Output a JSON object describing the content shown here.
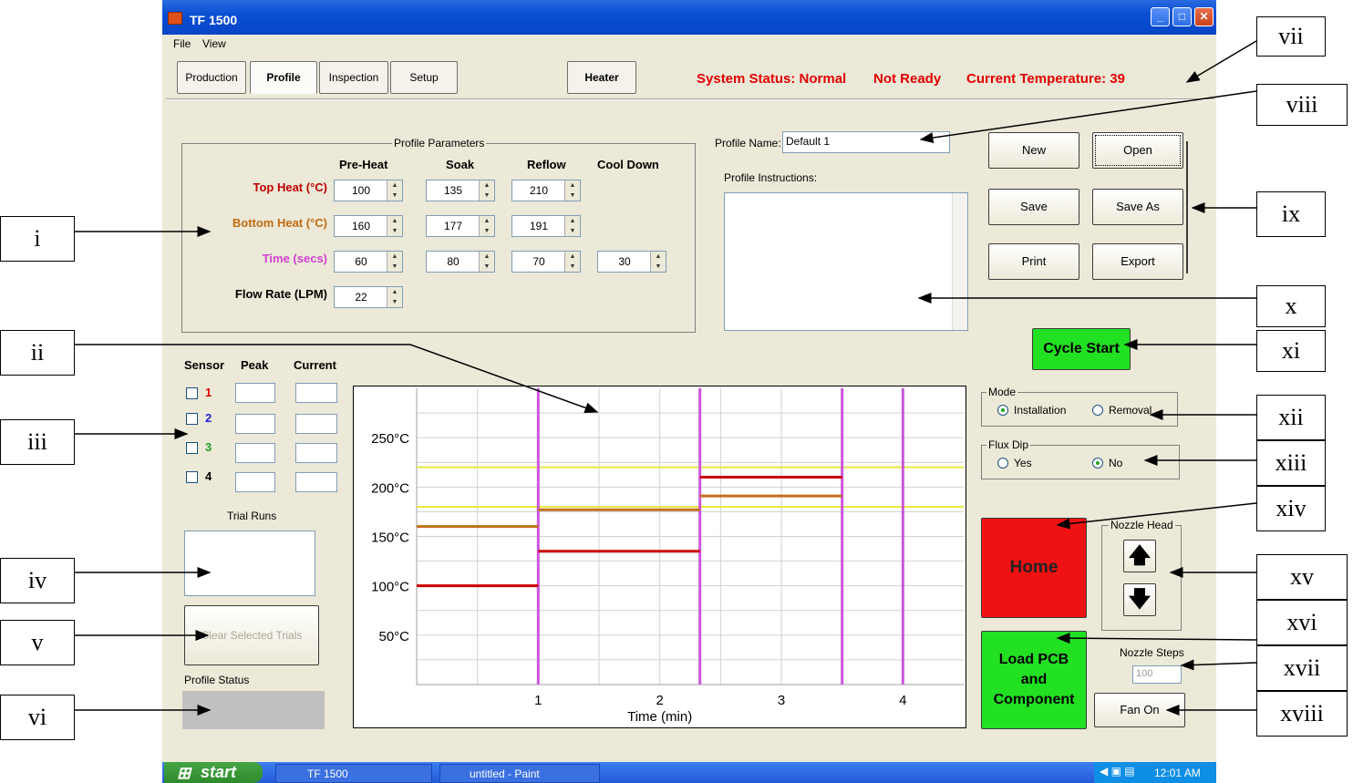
{
  "window": {
    "title": "TF 1500"
  },
  "menu": [
    "File",
    "View"
  ],
  "tabs": [
    "Production",
    "Profile",
    "Inspection",
    "Setup"
  ],
  "heater_button": "Heater",
  "status": {
    "system": "System Status: Normal",
    "ready": "Not Ready",
    "temperature": "Current Temperature: 39"
  },
  "profile_parameters": {
    "title": "Profile Parameters",
    "columns": [
      "Pre-Heat",
      "Soak",
      "Reflow",
      "Cool Down"
    ],
    "rows": [
      {
        "label": "Top Heat (°C)",
        "color": "#c00000",
        "values": [
          "100",
          "135",
          "210"
        ]
      },
      {
        "label": "Bottom Heat (°C)",
        "color": "#c06a10",
        "values": [
          "160",
          "177",
          "191"
        ]
      },
      {
        "label": "Time (secs)",
        "color": "#d040d0",
        "values": [
          "60",
          "80",
          "70",
          "30"
        ]
      },
      {
        "label": "Flow Rate (LPM)",
        "color": "#000000",
        "values": [
          "22"
        ]
      }
    ]
  },
  "profile_name": {
    "label": "Profile Name:",
    "value": "Default 1"
  },
  "profile_instructions": {
    "label": "Profile Instructions:"
  },
  "file_buttons": [
    "New",
    "Open",
    "Save",
    "Save As",
    "Print",
    "Export"
  ],
  "cycle_start": "Cycle Start",
  "mode": {
    "title": "Mode",
    "options": [
      "Installation",
      "Removal"
    ],
    "selected": "Installation"
  },
  "flux_dip": {
    "title": "Flux Dip",
    "options": [
      "Yes",
      "No"
    ],
    "selected": "No"
  },
  "home_button": "Home",
  "nozzle_head": {
    "title": "Nozzle Head"
  },
  "load_button": {
    "line1": "Load PCB",
    "line2": "and",
    "line3": "Component"
  },
  "nozzle_steps": {
    "label": "Nozzle Steps",
    "value": "100"
  },
  "fan_button": "Fan On",
  "sensors": {
    "headers": [
      "Sensor",
      "Peak",
      "Current"
    ],
    "items": [
      {
        "id": "1",
        "color": "#e00000"
      },
      {
        "id": "2",
        "color": "#2020d0"
      },
      {
        "id": "3",
        "color": "#20a020"
      },
      {
        "id": "4",
        "color": "#000000"
      }
    ]
  },
  "trial_runs": {
    "label": "Trial Runs"
  },
  "clear_trials": "Clear Selected Trials",
  "profile_status": {
    "label": "Profile Status"
  },
  "chart_data": {
    "type": "line",
    "xlabel": "Time (min)",
    "ylabel": "",
    "xlim": [
      -1.0,
      4.5
    ],
    "ylim": [
      0,
      300
    ],
    "x_ticks": [
      "1",
      "2",
      "3",
      "4"
    ],
    "y_ticks": [
      "50°C",
      "100°C",
      "150°C",
      "200°C",
      "250°C"
    ],
    "y_tick_values": [
      50,
      100,
      150,
      200,
      250
    ],
    "stage_boundaries_min": [
      1.0,
      2.33,
      3.5,
      4.0
    ],
    "reference_lines": [
      180,
      220
    ],
    "series": [
      {
        "color": "#cc0000",
        "segments": [
          [
            0.0,
            1.0,
            100
          ],
          [
            1.0,
            2.33,
            135
          ],
          [
            2.33,
            3.5,
            210
          ]
        ]
      },
      {
        "color": "#c0701a",
        "segments": [
          [
            0.0,
            1.0,
            160
          ],
          [
            1.0,
            2.33,
            177
          ],
          [
            2.33,
            3.5,
            191
          ]
        ]
      }
    ],
    "grid": true,
    "colors": {
      "boundary": "#cc55dd",
      "reference": "#e8e840"
    }
  },
  "callouts": [
    "i",
    "ii",
    "iii",
    "iv",
    "v",
    "vi",
    "vii",
    "viii",
    "ix",
    "x",
    "xi",
    "xii",
    "xiii",
    "xiv",
    "xv",
    "xvi",
    "xvii",
    "xviii"
  ],
  "taskbar": {
    "start": "start",
    "tasks": [
      "TF 1500",
      "untitled - Paint"
    ],
    "clock": "12:01 AM"
  }
}
